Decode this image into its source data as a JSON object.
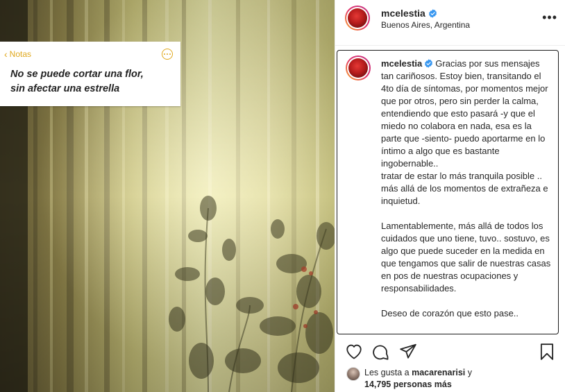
{
  "note": {
    "back_label": "Notas",
    "text_line1": "No se puede cortar una flor,",
    "text_line2": "sin afectar una estrella"
  },
  "header": {
    "username": "mcelestia",
    "location": "Buenos Aires, Argentina",
    "more_icon": "more-horizontal-icon"
  },
  "caption": {
    "username": "mcelestia",
    "text": "Gracias por sus mensajes tan cariñosos. Estoy bien, transitando el 4to día de síntomas, por momentos mejor que por otros, pero sin perder la calma, entendiendo que esto pasará -y que el miedo no colabora en nada, esa es la parte que -siento- puedo aportarme en lo íntimo a algo que es bastante ingobernable..\ntratar de estar lo más tranquila posible .. más allá de los momentos de extrañeza e inquietud.\n\nLamentablemente, más allá de todos los cuidados que uno tiene, tuvo.. sostuvo, es algo que puede suceder en la medida en que tengamos que salir de nuestras casas en pos de nuestras ocupaciones y responsabilidades.\n\nDeseo de corazón que esto pase.."
  },
  "actions": {
    "like_icon": "heart-icon",
    "comment_icon": "comment-icon",
    "share_icon": "send-icon",
    "save_icon": "bookmark-icon"
  },
  "likes": {
    "prefix": "Les gusta a ",
    "liker": "macarenarisi",
    "connector": " y",
    "count": "14,795",
    "suffix": " personas más"
  },
  "colors": {
    "verified_blue": "#3897f0",
    "notes_accent": "#e0a81d",
    "text": "#262626"
  }
}
